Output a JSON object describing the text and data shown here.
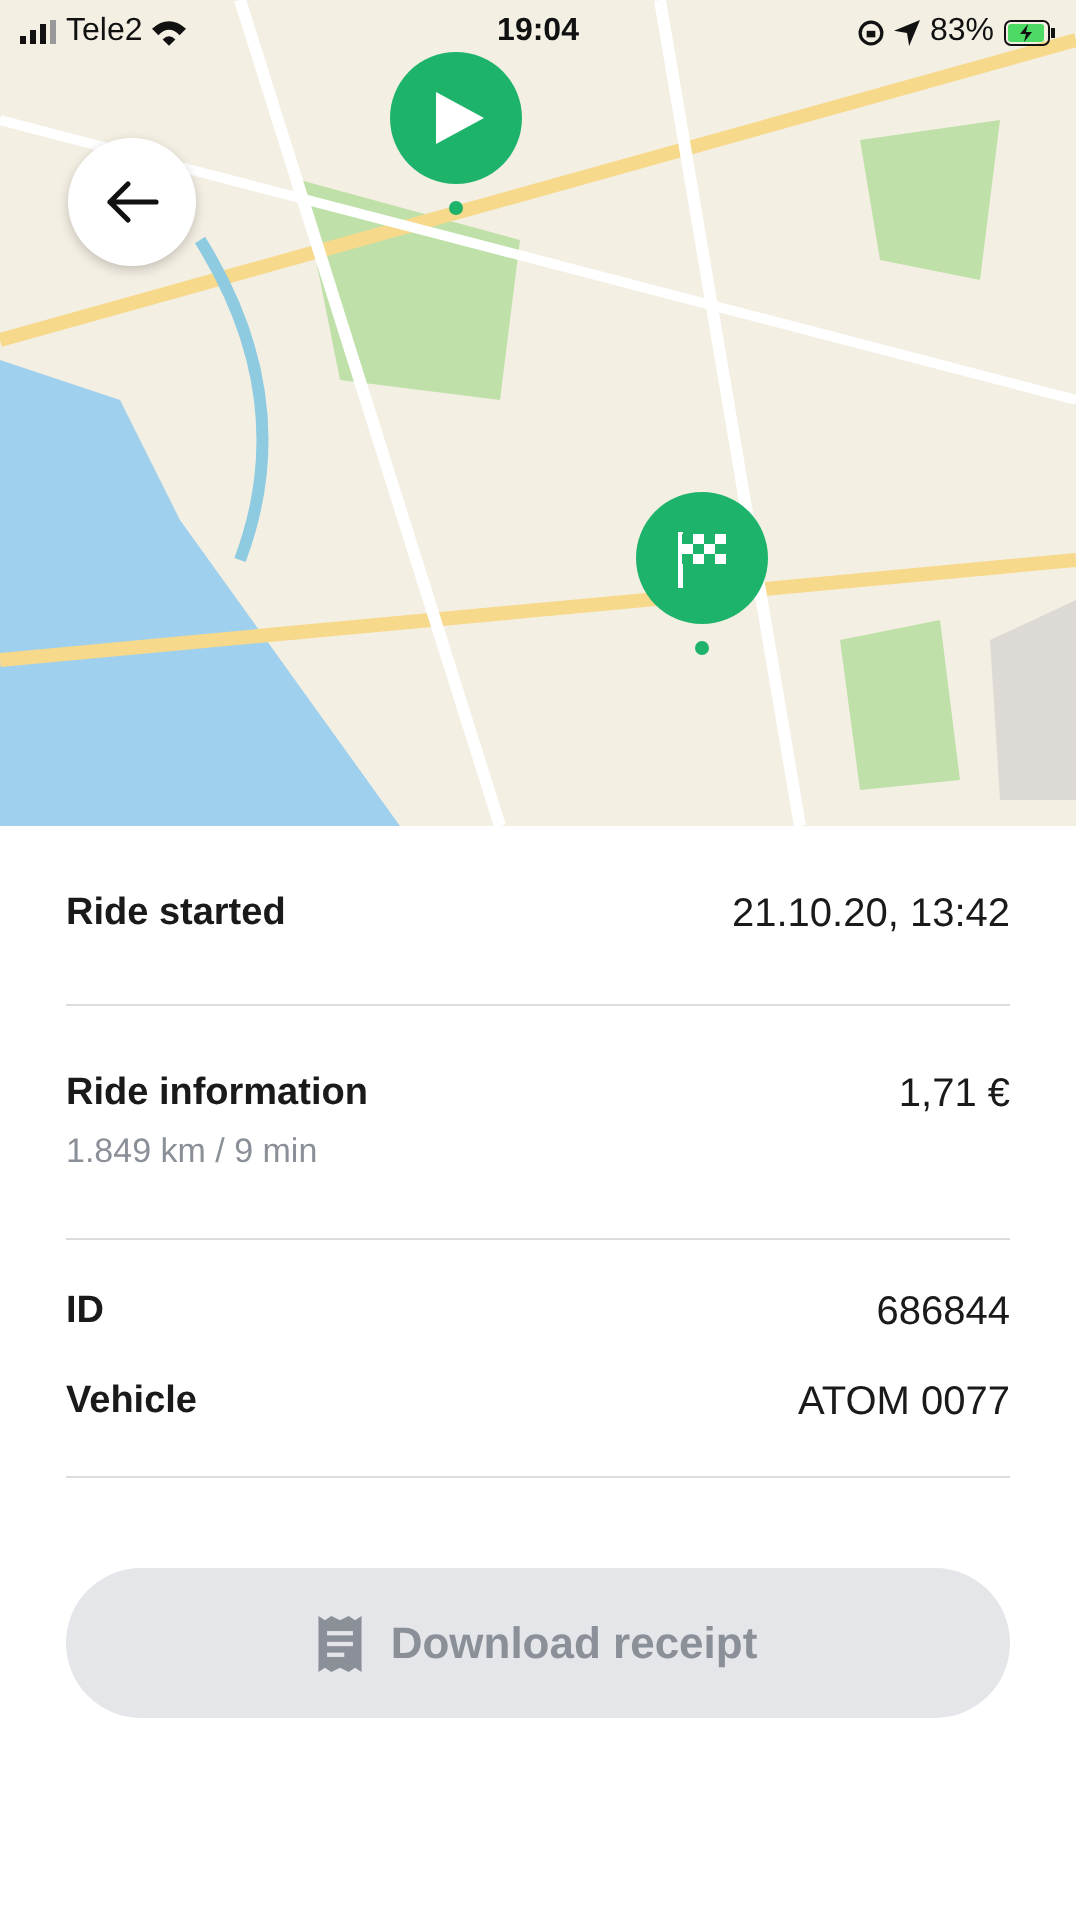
{
  "status_bar": {
    "carrier": "Tele2",
    "time": "19:04",
    "battery": "83%"
  },
  "sections": [
    {
      "rows": [
        {
          "label": "Ride started",
          "value": "21.10.20, 13:42"
        }
      ]
    },
    {
      "rows": [
        {
          "label": "Ride information",
          "sub": "1.849 km / 9 min",
          "value": "1,71 €"
        }
      ]
    },
    {
      "rows": [
        {
          "label": "ID",
          "value": "686844"
        },
        {
          "label": "Vehicle",
          "value": "ATOM 0077"
        }
      ]
    }
  ],
  "download_button": {
    "label": "Download receipt",
    "disabled": true
  }
}
